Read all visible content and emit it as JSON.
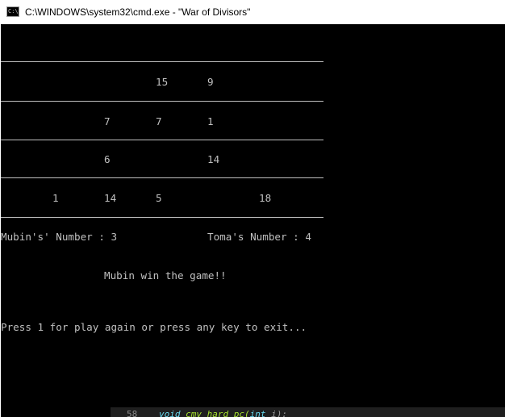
{
  "window": {
    "title": "C:\\WINDOWS\\system32\\cmd.exe - \"War of Divisors\"",
    "icon": "cmd-icon",
    "icon_text": "C:\\"
  },
  "board": {
    "row1": [
      "",
      "",
      "15",
      "9",
      ""
    ],
    "row2": [
      "",
      "7",
      "7",
      "1",
      ""
    ],
    "row3": [
      "",
      "6",
      "",
      "14",
      ""
    ],
    "row4": [
      "1",
      "14",
      "5",
      "",
      "18"
    ]
  },
  "scores": {
    "player1": "Mubin's' Number : 3",
    "player2": "Toma's Number : 4"
  },
  "result": "Mubin win the game!!",
  "prompt": "Press 1 for play again or press any key to exit...",
  "background_editor": {
    "line_number": "58",
    "code_keyword1": "void",
    "code_fn": "cmv_hard_pc(",
    "code_keyword2": "int",
    "code_rest": " i);"
  },
  "colors": {
    "console_bg": "#000000",
    "console_fg": "#c0c0c0",
    "titlebar_bg": "#ffffff"
  }
}
